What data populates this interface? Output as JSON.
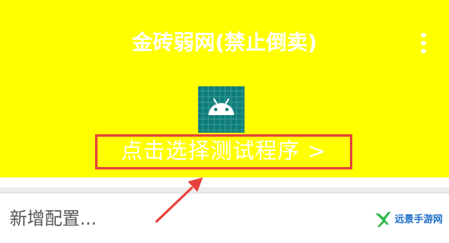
{
  "header": {
    "title": "金砖弱网(禁止倒卖)",
    "background_color": "#ffff00",
    "menu_icon": "more-vert-icon"
  },
  "app_icon": {
    "icon": "android-icon",
    "color": "#0e7c78"
  },
  "main": {
    "select_program_label": "点击选择测试程序 >",
    "highlight_color": "#e8423c"
  },
  "footer": {
    "config_input": {
      "placeholder": "新增配置...",
      "value": ""
    }
  },
  "watermark": {
    "text": "远景手游网",
    "color": "#1f6fc9"
  },
  "annotation": {
    "arrow_color": "#e8423c"
  }
}
